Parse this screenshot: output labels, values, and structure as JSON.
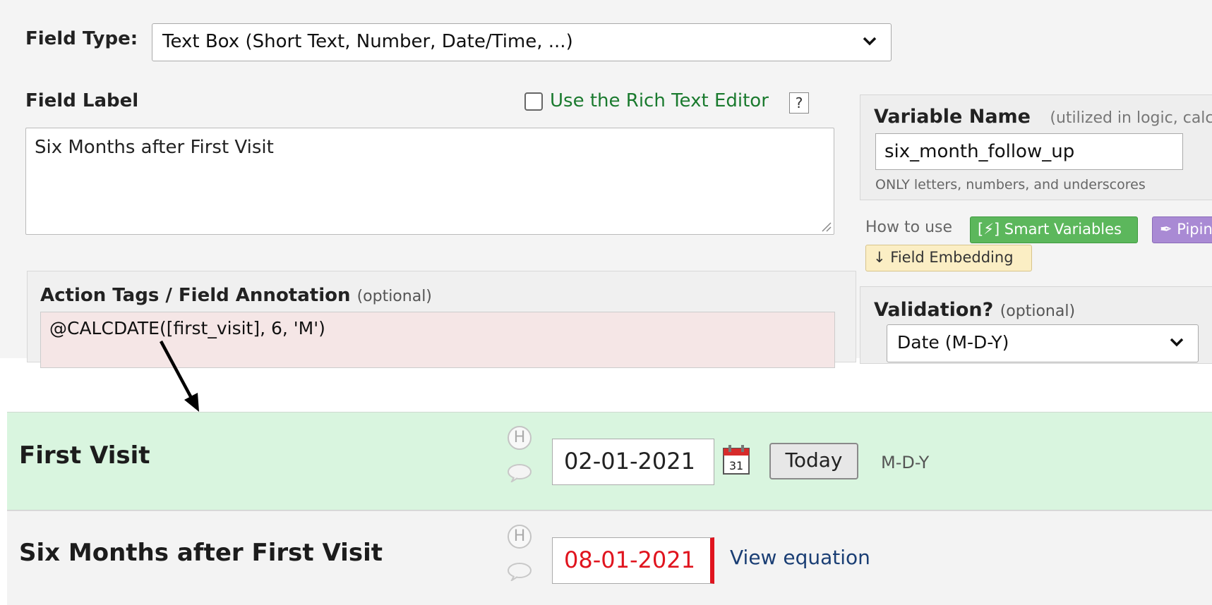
{
  "field_type": {
    "label": "Field Type:",
    "selected": "Text Box (Short Text, Number, Date/Time, ...)"
  },
  "field_label": {
    "label": "Field Label",
    "value": "Six Months after First Visit"
  },
  "rich_text": {
    "label": "Use the Rich Text Editor",
    "help": "?"
  },
  "variable": {
    "label": "Variable Name",
    "hint": "(utilized in logic, calc",
    "value": "six_month_follow_up",
    "note": "ONLY letters, numbers, and underscores"
  },
  "howto": {
    "label": "How to use",
    "smart_variables": "[⚡] Smart Variables",
    "piping": "✒ Piping",
    "field_embedding": "↓ Field Embedding"
  },
  "action_tags": {
    "label": "Action Tags / Field Annotation",
    "optional": "(optional)",
    "value": "@CALCDATE([first_visit], 6, 'M')"
  },
  "validation": {
    "label": "Validation?",
    "optional": "(optional)",
    "selected": "Date (M-D-Y)"
  },
  "form": {
    "first_visit": {
      "label": "First Visit",
      "value": "02-01-2021",
      "today_label": "Today",
      "format": "M-D-Y",
      "history_icon": "H",
      "calendar_day": "31"
    },
    "six_months": {
      "label": "Six Months after First Visit",
      "value": "08-01-2021",
      "view_equation": "View equation",
      "history_icon": "H"
    }
  },
  "colors": {
    "green_row": "#d9f5df",
    "annotation_bg": "#f5e6e6",
    "calc_red": "#e0141e",
    "rich_text_green": "#1a7a2e"
  }
}
